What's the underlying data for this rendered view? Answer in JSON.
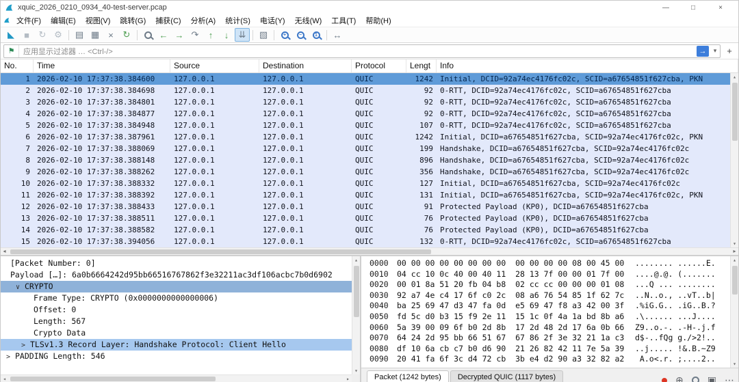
{
  "colors": {
    "accent_fin": "#1f9ec9",
    "row_quic_background": "#e3e9fb",
    "row_selected_background": "#5f9bd8",
    "detail_selected_background": "#8fb2d9",
    "detail_related_background": "#a6c8ef",
    "filter_apply_blue": "#3d7edb",
    "overlay_record_red": "#dd3524"
  },
  "window": {
    "title": "xquic_2026_0210_0934_40-test-server.pcap",
    "minimize": "—",
    "maximize": "□",
    "close": "×"
  },
  "menu": {
    "items": [
      "文件(F)",
      "编辑(E)",
      "视图(V)",
      "跳转(G)",
      "捕获(C)",
      "分析(A)",
      "统计(S)",
      "电话(Y)",
      "无线(W)",
      "工具(T)",
      "帮助(H)"
    ]
  },
  "toolbar": {
    "icons": [
      {
        "name": "capture-start-fin",
        "glyph": "◣"
      },
      {
        "name": "capture-stop",
        "glyph": "■"
      },
      {
        "name": "capture-restart",
        "glyph": "↻"
      },
      {
        "name": "capture-options",
        "glyph": "⚙"
      },
      {
        "name": "open-file",
        "glyph": "▤"
      },
      {
        "name": "save-file",
        "glyph": "▦"
      },
      {
        "name": "close-file",
        "glyph": "×"
      },
      {
        "name": "reload-file",
        "glyph": "↻"
      },
      {
        "name": "find-packet",
        "overlay": ""
      },
      {
        "name": "go-back",
        "glyph": "←"
      },
      {
        "name": "go-forward",
        "glyph": "→"
      },
      {
        "name": "go-to-packet",
        "glyph": "↷"
      },
      {
        "name": "first-packet",
        "glyph": "↑"
      },
      {
        "name": "last-packet",
        "glyph": "↓"
      },
      {
        "name": "auto-scroll",
        "glyph": "⇊"
      },
      {
        "name": "colorize",
        "glyph": "▧"
      },
      {
        "name": "zoom-in",
        "overlay": "+"
      },
      {
        "name": "zoom-out",
        "overlay": "−"
      },
      {
        "name": "zoom-original",
        "overlay": "1"
      },
      {
        "name": "resize-columns",
        "glyph": "↔"
      }
    ]
  },
  "filter": {
    "placeholder": "应用显示过滤器 … <Ctrl-/>",
    "bookmark": "⚑",
    "apply_arrow": "→",
    "dropdown_caret": "▾",
    "plus": "+"
  },
  "scrollbar": {
    "up": "▴",
    "down": "▾",
    "left": "◂",
    "right": "▸"
  },
  "packet_list": {
    "columns": [
      "No.",
      "Time",
      "Source",
      "Destination",
      "Protocol",
      "Lengt",
      "Info"
    ],
    "rows": [
      {
        "no": "1",
        "time": "2026-02-10 17:37:38.384600",
        "source": "127.0.0.1",
        "destination": "127.0.0.1",
        "protocol": "QUIC",
        "length": "1242",
        "info": "Initial, DCID=92a74ec4176fc02c, SCID=a67654851f627cba, PKN"
      },
      {
        "no": "2",
        "time": "2026-02-10 17:37:38.384698",
        "source": "127.0.0.1",
        "destination": "127.0.0.1",
        "protocol": "QUIC",
        "length": "92",
        "info": "0-RTT, DCID=92a74ec4176fc02c, SCID=a67654851f627cba"
      },
      {
        "no": "3",
        "time": "2026-02-10 17:37:38.384801",
        "source": "127.0.0.1",
        "destination": "127.0.0.1",
        "protocol": "QUIC",
        "length": "92",
        "info": "0-RTT, DCID=92a74ec4176fc02c, SCID=a67654851f627cba"
      },
      {
        "no": "4",
        "time": "2026-02-10 17:37:38.384877",
        "source": "127.0.0.1",
        "destination": "127.0.0.1",
        "protocol": "QUIC",
        "length": "92",
        "info": "0-RTT, DCID=92a74ec4176fc02c, SCID=a67654851f627cba"
      },
      {
        "no": "5",
        "time": "2026-02-10 17:37:38.384948",
        "source": "127.0.0.1",
        "destination": "127.0.0.1",
        "protocol": "QUIC",
        "length": "107",
        "info": "0-RTT, DCID=92a74ec4176fc02c, SCID=a67654851f627cba"
      },
      {
        "no": "6",
        "time": "2026-02-10 17:37:38.387961",
        "source": "127.0.0.1",
        "destination": "127.0.0.1",
        "protocol": "QUIC",
        "length": "1242",
        "info": "Initial, DCID=a67654851f627cba, SCID=92a74ec4176fc02c, PKN"
      },
      {
        "no": "7",
        "time": "2026-02-10 17:37:38.388069",
        "source": "127.0.0.1",
        "destination": "127.0.0.1",
        "protocol": "QUIC",
        "length": "199",
        "info": "Handshake, DCID=a67654851f627cba, SCID=92a74ec4176fc02c"
      },
      {
        "no": "8",
        "time": "2026-02-10 17:37:38.388148",
        "source": "127.0.0.1",
        "destination": "127.0.0.1",
        "protocol": "QUIC",
        "length": "896",
        "info": "Handshake, DCID=a67654851f627cba, SCID=92a74ec4176fc02c"
      },
      {
        "no": "9",
        "time": "2026-02-10 17:37:38.388262",
        "source": "127.0.0.1",
        "destination": "127.0.0.1",
        "protocol": "QUIC",
        "length": "356",
        "info": "Handshake, DCID=a67654851f627cba, SCID=92a74ec4176fc02c"
      },
      {
        "no": "10",
        "time": "2026-02-10 17:37:38.388332",
        "source": "127.0.0.1",
        "destination": "127.0.0.1",
        "protocol": "QUIC",
        "length": "127",
        "info": "Initial, DCID=a67654851f627cba, SCID=92a74ec4176fc02c"
      },
      {
        "no": "11",
        "time": "2026-02-10 17:37:38.388392",
        "source": "127.0.0.1",
        "destination": "127.0.0.1",
        "protocol": "QUIC",
        "length": "131",
        "info": "Initial, DCID=a67654851f627cba, SCID=92a74ec4176fc02c, PKN"
      },
      {
        "no": "12",
        "time": "2026-02-10 17:37:38.388433",
        "source": "127.0.0.1",
        "destination": "127.0.0.1",
        "protocol": "QUIC",
        "length": "91",
        "info": "Protected Payload (KP0), DCID=a67654851f627cba"
      },
      {
        "no": "13",
        "time": "2026-02-10 17:37:38.388511",
        "source": "127.0.0.1",
        "destination": "127.0.0.1",
        "protocol": "QUIC",
        "length": "76",
        "info": "Protected Payload (KP0), DCID=a67654851f627cba"
      },
      {
        "no": "14",
        "time": "2026-02-10 17:37:38.388582",
        "source": "127.0.0.1",
        "destination": "127.0.0.1",
        "protocol": "QUIC",
        "length": "76",
        "info": "Protected Payload (KP0), DCID=a67654851f627cba"
      },
      {
        "no": "15",
        "time": "2026-02-10 17:37:38.394056",
        "source": "127.0.0.1",
        "destination": "127.0.0.1",
        "protocol": "QUIC",
        "length": "132",
        "info": "0-RTT, DCID=92a74ec4176fc02c, SCID=a67654851f627cba"
      }
    ]
  },
  "detail_pane": {
    "lines": [
      {
        "expander": "",
        "text": "[Packet Number: 0]"
      },
      {
        "expander": "",
        "text": "Payload […]: 6a0b6664242d95bb66516767862f3e32211ac3df106acbc7b0d6902"
      },
      {
        "expander": "∨",
        "text": "CRYPTO"
      },
      {
        "expander": "",
        "text": "Frame Type: CRYPTO (0x0000000000000006)"
      },
      {
        "expander": "",
        "text": "Offset: 0"
      },
      {
        "expander": "",
        "text": "Length: 567"
      },
      {
        "expander": "",
        "text": "Crypto Data"
      },
      {
        "expander": ">",
        "text": "TLSv1.3 Record Layer: Handshake Protocol: Client Hello"
      },
      {
        "expander": ">",
        "text": "PADDING Length: 546"
      }
    ]
  },
  "hex_pane": {
    "rows": [
      {
        "offset": "0000",
        "hex": "00 00 00 00 00 00 00 00  00 00 00 00 08 00 45 00",
        "ascii": "........ ......E."
      },
      {
        "offset": "0010",
        "hex": "04 cc 10 0c 40 00 40 11  28 13 7f 00 00 01 7f 00",
        "ascii": "....@.@. (......."
      },
      {
        "offset": "0020",
        "hex": "00 01 8a 51 20 fb 04 b8  02 cc cc 00 00 00 01 08",
        "ascii": "...Q ... ........"
      },
      {
        "offset": "0030",
        "hex": "92 a7 4e c4 17 6f c0 2c  08 a6 76 54 85 1f 62 7c",
        "ascii": "..N..o., ..vT..b|"
      },
      {
        "offset": "0040",
        "hex": "ba 25 69 47 d3 47 fa 0d  e5 69 47 f8 a3 42 00 3f",
        "ascii": ".%iG.G.. .iG..B.?"
      },
      {
        "offset": "0050",
        "hex": "fd 5c d0 b3 15 f9 2e 11  15 1c 0f 4a 1a bd 8b a6",
        "ascii": ".\\...... ...J...."
      },
      {
        "offset": "0060",
        "hex": "5a 39 00 09 6f b0 2d 8b  17 2d 48 2d 17 6a 0b 66",
        "ascii": "Z9..o.-. .-H-.j.f"
      },
      {
        "offset": "0070",
        "hex": "64 24 2d 95 bb 66 51 67  67 86 2f 3e 32 21 1a c3",
        "ascii": "d$-..fQg g./>2!.."
      },
      {
        "offset": "0080",
        "hex": "df 10 6a cb c7 b0 d6 90  21 26 82 42 11 7e 5a 39",
        "ascii": "..j..... !&.B.~Z9"
      },
      {
        "offset": "0090",
        "hex": "20 41 fa 6f 3c d4 72 cb  3b e4 d2 90 a3 32 82 a2",
        "ascii": " A.o<.r. ;....2.."
      }
    ],
    "tabs": [
      {
        "label": "Packet (1242 bytes)"
      },
      {
        "label": "Decrypted QUIC (1117 bytes)"
      }
    ]
  },
  "overlay": {
    "icons": [
      {
        "name": "record-dot",
        "glyph": ""
      },
      {
        "name": "crosshair",
        "glyph": "⊕"
      },
      {
        "name": "magnifier",
        "glyph": ""
      },
      {
        "name": "image",
        "glyph": "▣"
      },
      {
        "name": "more",
        "glyph": "⋯"
      }
    ]
  }
}
